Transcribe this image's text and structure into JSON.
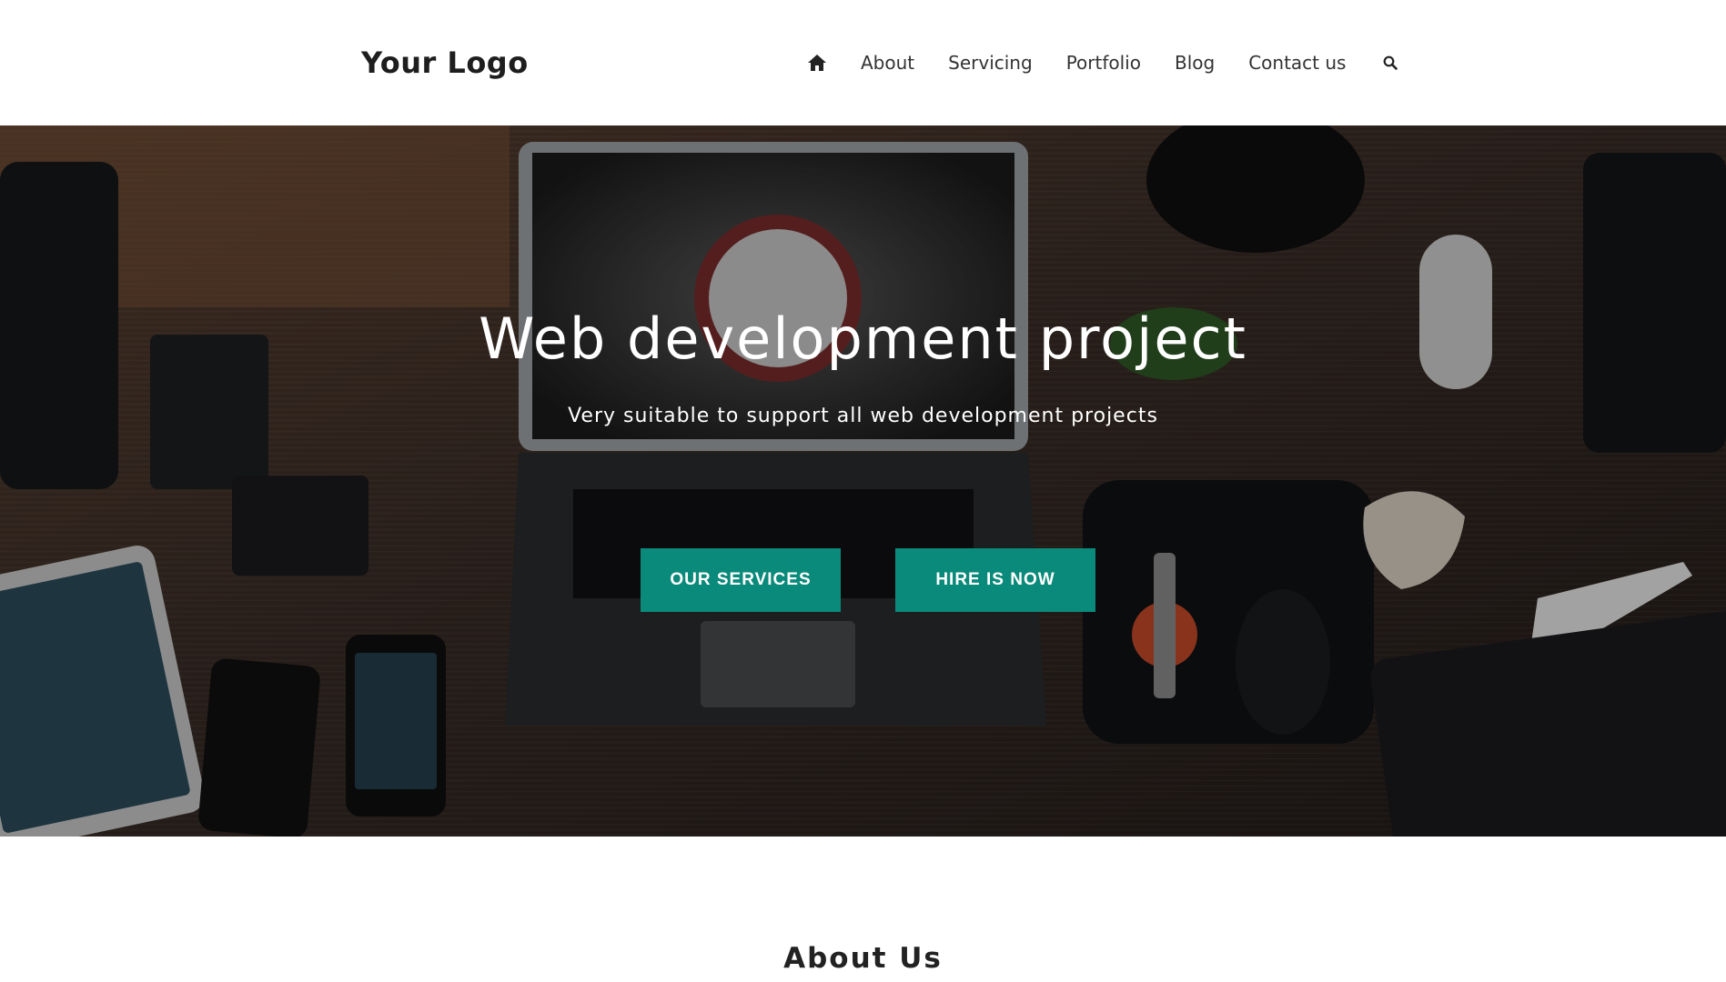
{
  "header": {
    "logo": "Your Logo",
    "home_icon": "home-icon",
    "nav": [
      "About",
      "Servicing",
      "Portfolio",
      "Blog",
      "Contact us"
    ],
    "search_icon": "search-icon"
  },
  "hero": {
    "title": "Web development project",
    "subtitle": "Very suitable to support all web development projects",
    "buttons": {
      "services": "OUR SERVICES",
      "hire": "HIRE IS NOW"
    },
    "accent_color": "#0a8a7a"
  },
  "about": {
    "title": "About Us"
  }
}
